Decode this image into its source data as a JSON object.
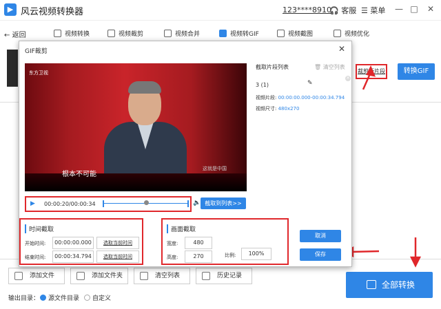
{
  "app": {
    "logo_glyph": "▶",
    "title": "风云视频转换器",
    "user_id": "123****8910",
    "service": "客服",
    "menu": "菜单"
  },
  "window_controls": {
    "min": "—",
    "max": "□",
    "close": "✕"
  },
  "toolbar": {
    "back": "返回",
    "tools": [
      {
        "label": "视频转换",
        "icon": "convert-icon"
      },
      {
        "label": "视频裁剪",
        "icon": "crop-icon"
      },
      {
        "label": "视频合并",
        "icon": "merge-icon"
      },
      {
        "label": "视频转GIF",
        "icon": "gif-icon",
        "active": true
      },
      {
        "label": "视频截图",
        "icon": "screenshot-icon"
      },
      {
        "label": "视频优化",
        "icon": "optimize-icon"
      }
    ]
  },
  "right_panel": {
    "new_clip": "裁剪新片段",
    "to_gif": "转换GIF"
  },
  "bottom": {
    "add_file": "添加文件",
    "add_folder": "添加文件夹",
    "clear_list": "清空列表",
    "history": "历史记录",
    "convert_all": "全部转换",
    "output_label": "输出目录：",
    "option_source": "源文件目录",
    "option_custom": "自定义"
  },
  "dialog": {
    "title": "GIF裁剪",
    "close": "✕",
    "video": {
      "logo": "东方卫视",
      "subtitle": "根本不可能",
      "corner": "这就是中国"
    },
    "player": {
      "play": "▶",
      "time": "00:00:20/00:00:34",
      "add_to_list": "截取到列表>>"
    },
    "clip_list": {
      "title": "截取片段列表",
      "clear": "清空列表",
      "item": {
        "name": "3 (1)",
        "segment_label": "视频片段:",
        "segment_value": "00:00:00.000-00:00:34.794",
        "size_label": "视频尺寸:",
        "size_value": "480x270"
      }
    },
    "time_section": {
      "title": "时间截取",
      "start_label": "开始时间:",
      "start_value": "00:00:00.000",
      "end_label": "结束时间:",
      "end_value": "00:00:34.794",
      "pick_current": "选取当前时间"
    },
    "frame_section": {
      "title": "画面截取",
      "width_label": "宽度:",
      "width_value": "480",
      "height_label": "高度:",
      "height_value": "270",
      "ratio_label": "比例:",
      "ratio_value": "100%"
    },
    "cancel": "取消",
    "save": "保存"
  },
  "colors": {
    "accent": "#2f86e6",
    "highlight": "#e0272b"
  }
}
